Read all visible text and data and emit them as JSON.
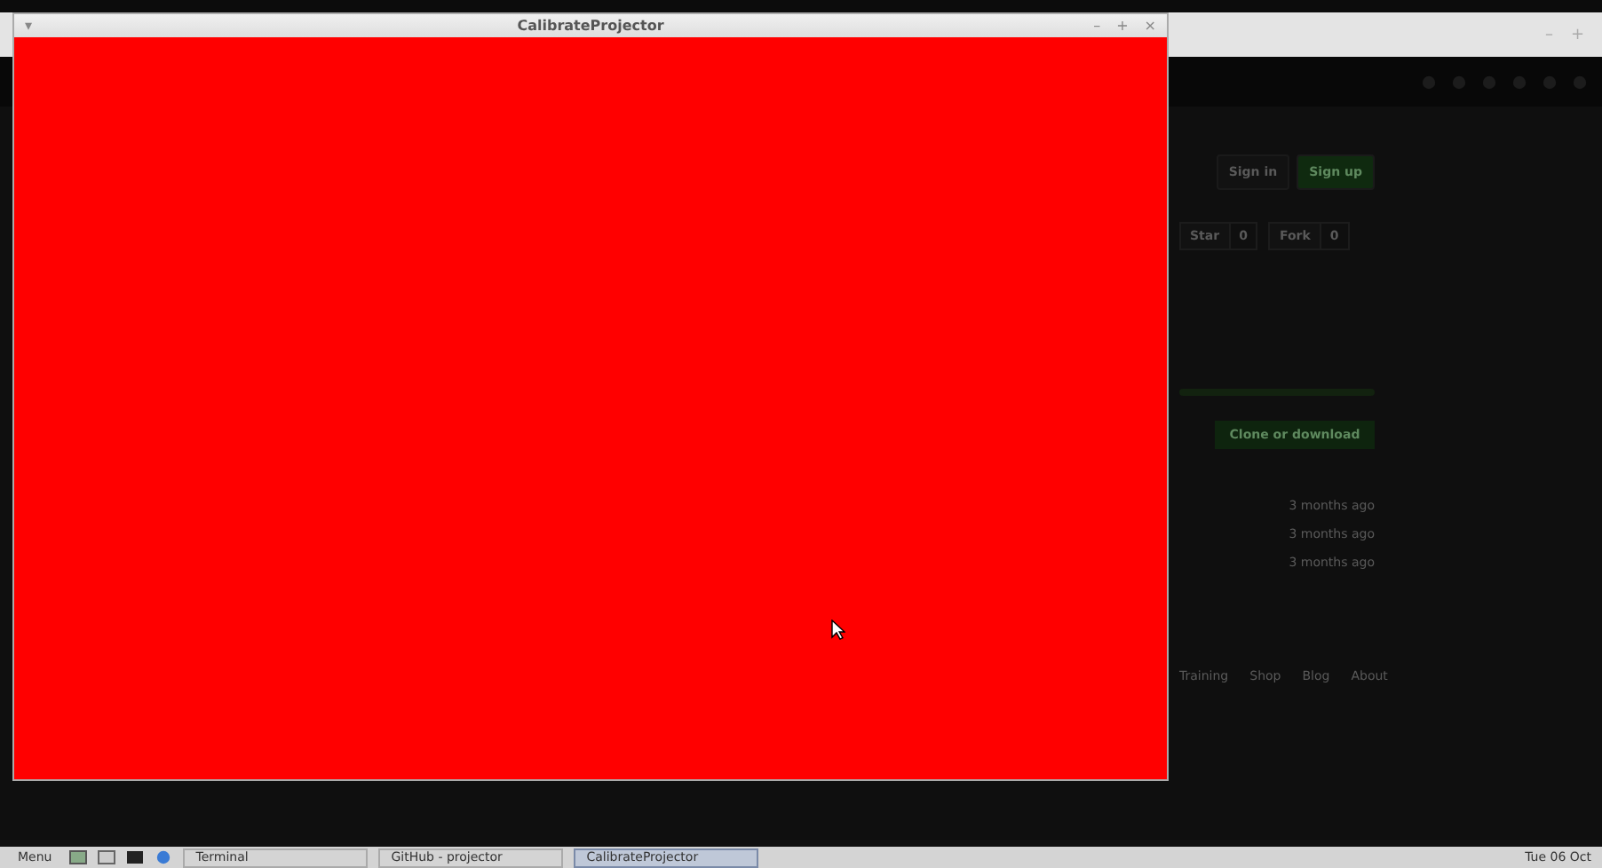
{
  "back_window": {
    "controls": [
      "–",
      "+"
    ],
    "page": {
      "header_buttons": [
        {
          "label": "Sign in",
          "kind": "plain"
        },
        {
          "label": "Sign up",
          "kind": "primary"
        }
      ],
      "repo_actions": [
        {
          "label": "Star",
          "count": "0"
        },
        {
          "label": "Fork",
          "count": "0"
        }
      ],
      "clone_button": "Clone or download",
      "file_times": [
        "3 months ago",
        "3 months ago",
        "3 months ago"
      ],
      "footer_links": [
        "Training",
        "Shop",
        "Blog",
        "About"
      ]
    }
  },
  "window": {
    "menu_glyph": "▾",
    "title": "CalibrateProjector",
    "controls": [
      "–",
      "+",
      "×"
    ]
  },
  "taskbar": {
    "menu": "Menu",
    "tasks": [
      {
        "label": "Terminal",
        "selected": false
      },
      {
        "label": "GitHub - projector",
        "selected": false
      },
      {
        "label": "CalibrateProjector",
        "selected": true
      }
    ],
    "clock": "Tue 06 Oct"
  }
}
